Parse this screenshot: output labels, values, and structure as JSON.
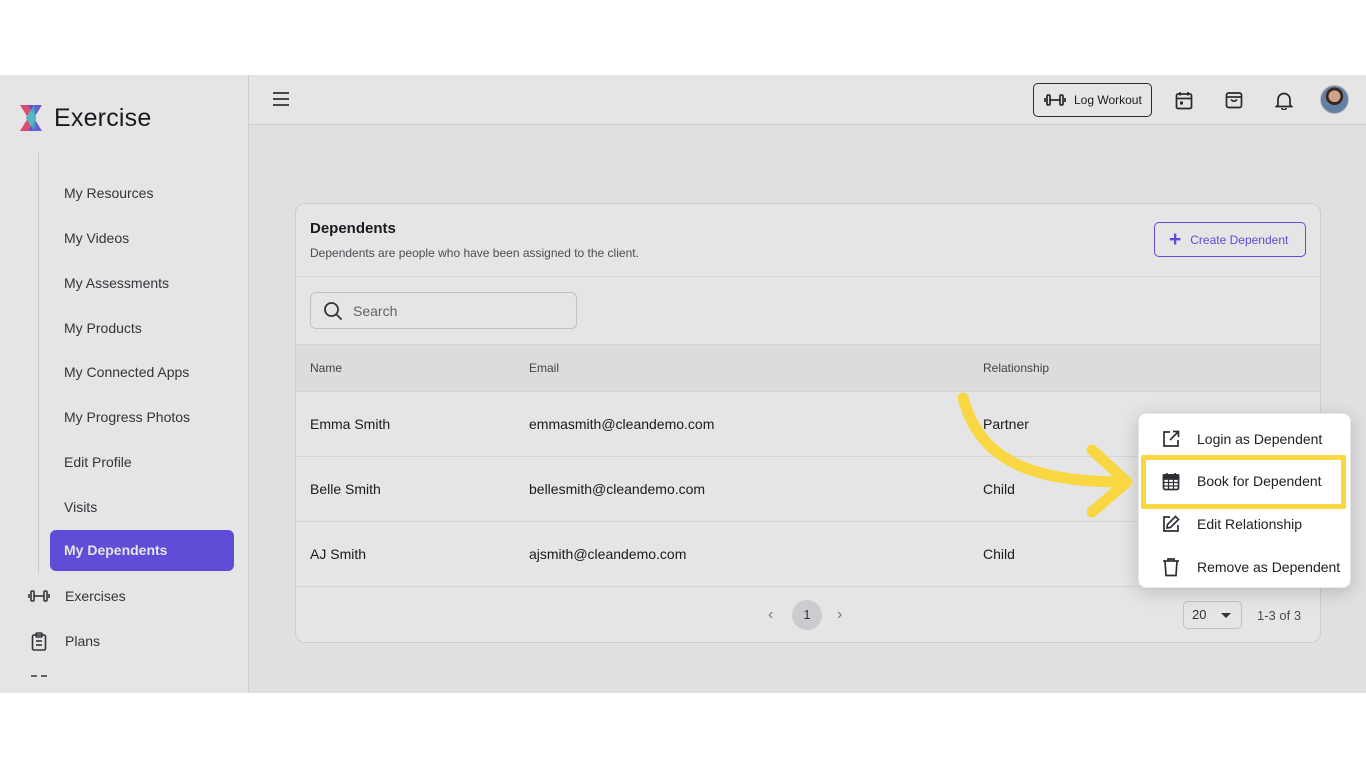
{
  "app": {
    "name": "Exercise"
  },
  "sidebar": {
    "items": [
      {
        "label": "My Resources"
      },
      {
        "label": "My Videos"
      },
      {
        "label": "My Assessments"
      },
      {
        "label": "My Products"
      },
      {
        "label": "My Connected Apps"
      },
      {
        "label": "My Progress Photos"
      },
      {
        "label": "Edit Profile"
      },
      {
        "label": "Visits"
      },
      {
        "label": "My Dependents",
        "active": true
      }
    ],
    "top_items": [
      {
        "label": "Exercises",
        "icon": "dumbbell-icon"
      },
      {
        "label": "Plans",
        "icon": "clipboard-icon"
      }
    ]
  },
  "header": {
    "log_workout_label": "Log Workout",
    "icons": [
      "calendar-icon",
      "shopping-bag-icon",
      "bell-icon",
      "avatar"
    ]
  },
  "dependents": {
    "title": "Dependents",
    "subtitle": "Dependents are people who have been assigned to the client.",
    "create_label": "Create Dependent",
    "search_placeholder": "Search",
    "columns": [
      "Name",
      "Email",
      "Relationship"
    ],
    "rows": [
      {
        "name": "Emma Smith",
        "email": "emmasmith@cleandemo.com",
        "relationship": "Partner"
      },
      {
        "name": "Belle Smith",
        "email": "bellesmith@cleandemo.com",
        "relationship": "Child"
      },
      {
        "name": "AJ Smith",
        "email": "ajsmith@cleandemo.com",
        "relationship": "Child"
      }
    ],
    "pagination": {
      "current_page": "1",
      "per_page": "20",
      "range": "1-3 of 3"
    }
  },
  "dropdown": {
    "items": [
      {
        "label": "Login as Dependent",
        "icon": "external-link-icon"
      },
      {
        "label": "Book for Dependent",
        "icon": "calendar-grid-icon",
        "highlighted": true
      },
      {
        "label": "Edit Relationship",
        "icon": "edit-icon"
      },
      {
        "label": "Remove as Dependent",
        "icon": "trash-icon"
      }
    ]
  },
  "colors": {
    "accent": "#6a55f0",
    "highlight": "#f8d742"
  }
}
